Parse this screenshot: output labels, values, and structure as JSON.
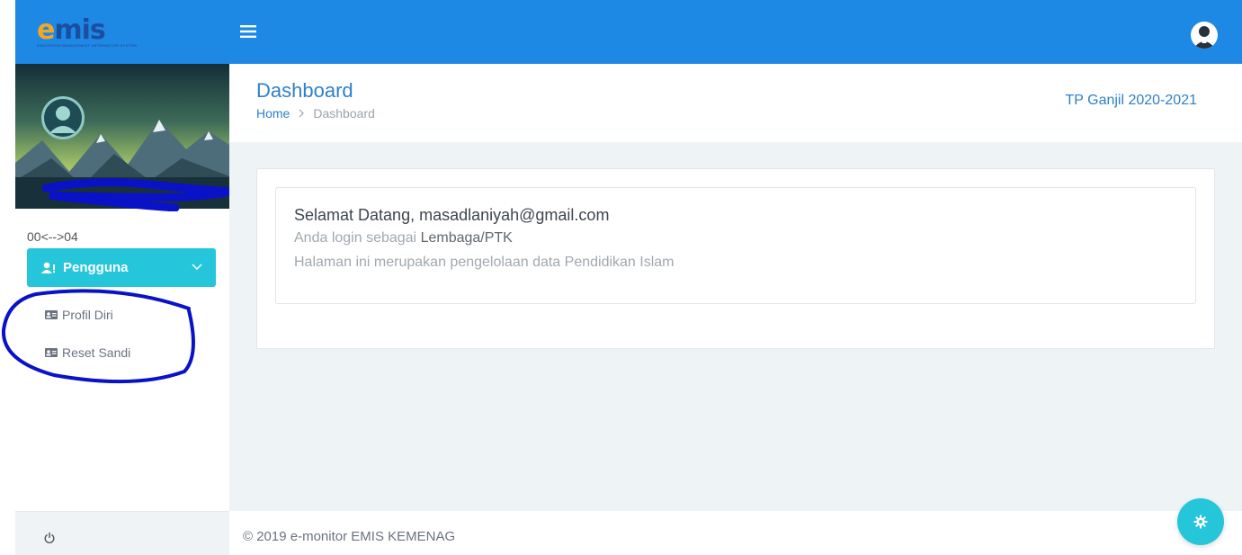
{
  "brand": {
    "logo_text_e": "e",
    "logo_text_rest": "mis",
    "logo_subtitle": "EDUCATION MANAGEMENT INFORMATION SYSTEM",
    "logo_icon": "emis-logo"
  },
  "sidebar": {
    "version": "00<-->04",
    "group": {
      "label": "Pengguna",
      "icon": "user-key-icon",
      "expanded": true
    },
    "items": [
      {
        "label": "Profil Diri",
        "icon": "id-card-icon"
      },
      {
        "label": "Reset Sandi",
        "icon": "id-card-icon"
      }
    ],
    "footer_icon": "power-icon"
  },
  "header": {
    "menu_icon": "hamburger-icon",
    "avatar_icon": "user-avatar-icon"
  },
  "page": {
    "title": "Dashboard",
    "breadcrumb": {
      "home": "Home",
      "current": "Dashboard"
    },
    "period": "TP Ganjil 2020-2021"
  },
  "welcome": {
    "greeting": "Selamat Datang, masadlaniyah@gmail.com",
    "login_prefix": "Anda login sebagai ",
    "login_role": "Lembaga/PTK",
    "description": "Halaman ini merupakan pengelolaan data Pendidikan Islam"
  },
  "footer": {
    "copyright": "© 2019 e-monitor EMIS KEMENAG",
    "settings_icon": "gear-icon"
  },
  "colors": {
    "primary": "#1e88e5",
    "accent": "#26c6da",
    "title": "#2f80c8",
    "annotation": "#0a12c8"
  }
}
